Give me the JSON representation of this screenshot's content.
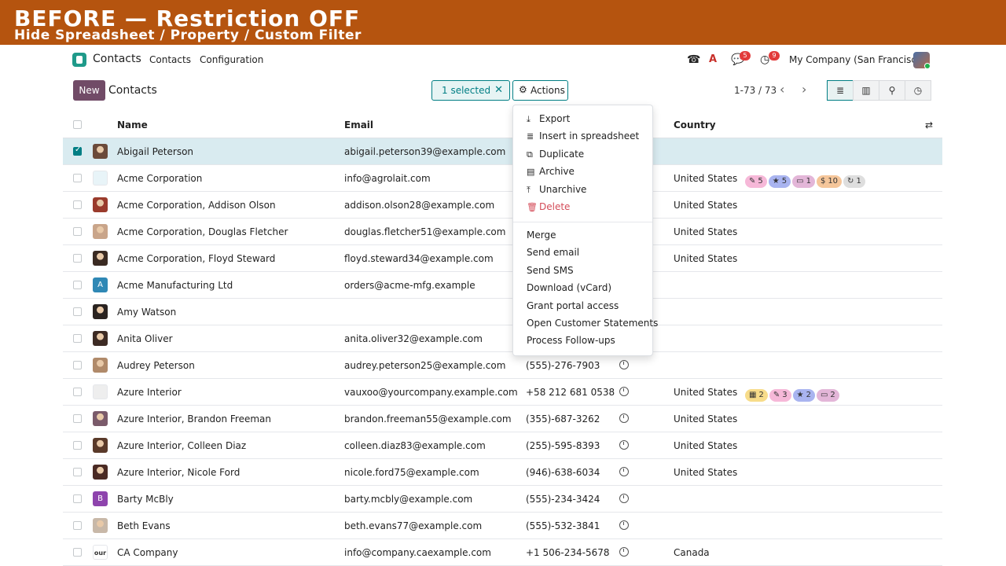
{
  "banner": {
    "title": "BEFORE — Restriction OFF",
    "subtitle": "Hide Spreadsheet / Property / Custom Filter"
  },
  "navbar": {
    "app_name": "Contacts",
    "links": [
      "Contacts",
      "Configuration"
    ],
    "messages_badge": "5",
    "activities_badge": "9",
    "company": "My Company (San Francisco)"
  },
  "controlbar": {
    "new_label": "New",
    "title": "Contacts",
    "selected_label": "1 selected",
    "actions_label": "Actions",
    "pager": "1-73 / 73"
  },
  "table": {
    "headers": {
      "name": "Name",
      "email": "Email",
      "country": "Country"
    },
    "rows": [
      {
        "name": "Abigail Peterson",
        "email": "abigail.peterson39@example.com",
        "phone": "",
        "country": "",
        "selected": true,
        "avatar": "photo",
        "avatar_color": "#6b4a3a",
        "tags": []
      },
      {
        "name": "Acme Corporation",
        "email": "info@agrolait.com",
        "phone": "",
        "country": "United States",
        "avatar": "logo",
        "avatar_color": "#e8f4f8",
        "tags": [
          {
            "icon": "✎",
            "count": "5",
            "color": "#f6b8d8"
          },
          {
            "icon": "★",
            "count": "5",
            "color": "#a9b4f0"
          },
          {
            "icon": "▭",
            "count": "1",
            "color": "#e3b6d8"
          },
          {
            "icon": "$",
            "count": "10",
            "color": "#f5c69a"
          },
          {
            "icon": "↻",
            "count": "1",
            "color": "#dedede"
          }
        ]
      },
      {
        "name": "Acme Corporation, Addison Olson",
        "email": "addison.olson28@example.com",
        "phone": "",
        "country": "United States",
        "avatar": "photo",
        "avatar_color": "#9a3b2c",
        "tags": []
      },
      {
        "name": "Acme Corporation, Douglas Fletcher",
        "email": "douglas.fletcher51@example.com",
        "phone": "",
        "country": "United States",
        "avatar": "photo",
        "avatar_color": "#c9a58a",
        "tags": []
      },
      {
        "name": "Acme Corporation, Floyd Steward",
        "email": "floyd.steward34@example.com",
        "phone": "",
        "country": "United States",
        "avatar": "photo",
        "avatar_color": "#3a2a22",
        "tags": []
      },
      {
        "name": "Acme Manufacturing Ltd",
        "email": "orders@acme-mfg.example",
        "phone": "",
        "country": "",
        "avatar": "letter",
        "letter": "A",
        "avatar_color": "#2f88b5",
        "tags": []
      },
      {
        "name": "Amy Watson",
        "email": "",
        "phone": "",
        "country": "",
        "avatar": "photo",
        "avatar_color": "#2a2320",
        "tags": []
      },
      {
        "name": "Anita Oliver",
        "email": "anita.oliver32@example.com",
        "phone": "",
        "country": "",
        "avatar": "photo",
        "avatar_color": "#3d2b24",
        "tags": []
      },
      {
        "name": "Audrey Peterson",
        "email": "audrey.peterson25@example.com",
        "phone": "(555)-276-7903",
        "country": "",
        "avatar": "photo",
        "avatar_color": "#b08a6a",
        "tags": []
      },
      {
        "name": "Azure Interior",
        "email": "vauxoo@yourcompany.example.com",
        "phone": "+58 212 681 0538",
        "country": "United States",
        "avatar": "logo",
        "avatar_color": "#eeeeee",
        "tags": [
          {
            "icon": "▦",
            "count": "2",
            "color": "#f7dc8a"
          },
          {
            "icon": "✎",
            "count": "3",
            "color": "#f6b8d8"
          },
          {
            "icon": "★",
            "count": "2",
            "color": "#a9b4f0"
          },
          {
            "icon": "▭",
            "count": "2",
            "color": "#e3b6d8"
          }
        ]
      },
      {
        "name": "Azure Interior, Brandon Freeman",
        "email": "brandon.freeman55@example.com",
        "phone": "(355)-687-3262",
        "country": "United States",
        "avatar": "photo",
        "avatar_color": "#7a5a6a",
        "tags": []
      },
      {
        "name": "Azure Interior, Colleen Diaz",
        "email": "colleen.diaz83@example.com",
        "phone": "(255)-595-8393",
        "country": "United States",
        "avatar": "photo",
        "avatar_color": "#5a3a2a",
        "tags": []
      },
      {
        "name": "Azure Interior, Nicole Ford",
        "email": "nicole.ford75@example.com",
        "phone": "(946)-638-6034",
        "country": "United States",
        "avatar": "photo",
        "avatar_color": "#4a2a24",
        "tags": []
      },
      {
        "name": "Barty McBly",
        "email": "barty.mcbly@example.com",
        "phone": "(555)-234-3424",
        "country": "",
        "avatar": "letter",
        "letter": "B",
        "avatar_color": "#8e44ad",
        "tags": []
      },
      {
        "name": "Beth Evans",
        "email": "beth.evans77@example.com",
        "phone": "(555)-532-3841",
        "country": "",
        "avatar": "photo",
        "avatar_color": "#c8b8a8",
        "tags": []
      },
      {
        "name": "CA Company",
        "email": "info@company.caexample.com",
        "phone": "+1 506-234-5678",
        "country": "Canada",
        "avatar": "logo",
        "logo_text": "our l",
        "avatar_color": "#ffffff",
        "tags": []
      }
    ]
  },
  "actions_menu": {
    "items": [
      {
        "icon": "⤓",
        "label": "Export"
      },
      {
        "icon": "≣",
        "label": "Insert in spreadsheet"
      },
      {
        "icon": "⧉",
        "label": "Duplicate"
      },
      {
        "icon": "▤",
        "label": "Archive"
      },
      {
        "icon": "⤒",
        "label": "Unarchive"
      },
      {
        "icon": "🗑",
        "label": "Delete",
        "danger": true
      }
    ],
    "extra": [
      "Merge",
      "Send email",
      "Send SMS",
      "Download (vCard)",
      "Grant portal access",
      "Open Customer Statements",
      "Process Follow-ups"
    ]
  },
  "colors": {
    "banner": "#b5540f",
    "accent": "#017e84",
    "primary": "#714b67",
    "selected_row": "#d9ebf0",
    "danger": "#d44c59"
  }
}
